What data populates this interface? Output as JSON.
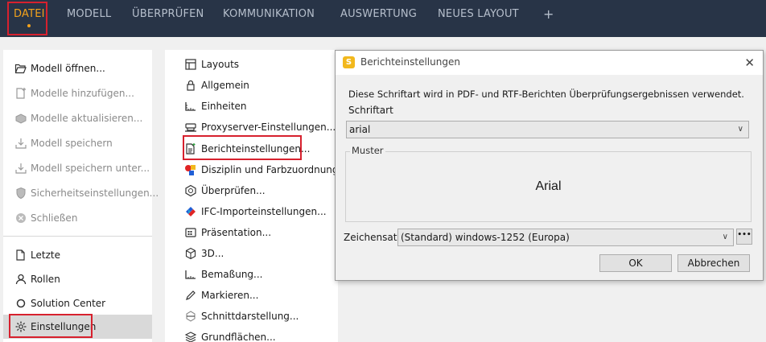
{
  "nav": {
    "tabs": [
      {
        "label": "DATEI",
        "active": true
      },
      {
        "label": "MODELL"
      },
      {
        "label": "ÜBERPRÜFEN"
      },
      {
        "label": "KOMMUNIKATION"
      },
      {
        "label": "AUSWERTUNG"
      },
      {
        "label": "NEUES LAYOUT"
      }
    ],
    "add_label": "+"
  },
  "sidebar": {
    "items": [
      {
        "label": "Modell öffnen...",
        "icon": "folder-open-icon",
        "enabled": true
      },
      {
        "label": "Modelle hinzufügen...",
        "icon": "add-file-icon",
        "enabled": false
      },
      {
        "label": "Modelle aktualisieren...",
        "icon": "refresh-models-icon",
        "enabled": false
      },
      {
        "label": "Modell speichern",
        "icon": "save-download-icon",
        "enabled": false
      },
      {
        "label": "Modell speichern unter...",
        "icon": "save-as-icon",
        "enabled": false
      },
      {
        "label": "Sicherheitseinstellungen...",
        "icon": "shield-icon",
        "enabled": false
      },
      {
        "label": "Schließen",
        "icon": "close-circle-icon",
        "enabled": false
      },
      {
        "label": "Letzte",
        "icon": "recent-file-icon",
        "enabled": true
      },
      {
        "label": "Rollen",
        "icon": "user-icon",
        "enabled": true
      },
      {
        "label": "Solution Center",
        "icon": "circle-icon",
        "enabled": true
      },
      {
        "label": "Einstellungen",
        "icon": "gear-icon",
        "enabled": true,
        "selected": true
      }
    ]
  },
  "settings": {
    "items": [
      {
        "label": "Layouts",
        "icon": "layout-grid-icon"
      },
      {
        "label": "Allgemein",
        "icon": "lock-icon"
      },
      {
        "label": "Einheiten",
        "icon": "ruler-icon"
      },
      {
        "label": "Proxyserver-Einstellungen...",
        "icon": "server-icon"
      },
      {
        "label": "Berichteinstellungen...",
        "icon": "report-file-icon"
      },
      {
        "label": "Disziplin und Farbzuordnung...",
        "icon": "color-shapes-icon"
      },
      {
        "label": "Überprüfen...",
        "icon": "check-shield-icon"
      },
      {
        "label": "IFC-Importeinstellungen...",
        "icon": "ifc-icon"
      },
      {
        "label": "Präsentation...",
        "icon": "presentation-icon"
      },
      {
        "label": "3D...",
        "icon": "cube-icon"
      },
      {
        "label": "Bemaßung...",
        "icon": "dimension-icon"
      },
      {
        "label": "Markieren...",
        "icon": "pencil-icon"
      },
      {
        "label": "Schnittdarstellung...",
        "icon": "section-icon"
      },
      {
        "label": "Grundflächen...",
        "icon": "layers-icon"
      }
    ]
  },
  "dialog": {
    "title": "Berichteinstellungen",
    "logo_letter": "S",
    "close_label": "✕",
    "description": "Diese Schriftart wird in PDF- und RTF-Berichten Überprüfungsergebnissen verwendet.",
    "font_label": "Schriftart",
    "font_value": "arial",
    "sample_label": "Muster",
    "sample_text": "Arial",
    "charset_label": "Zeichensatz",
    "charset_value": "(Standard) windows-1252 (Europa)",
    "more_label": "•••",
    "ok_label": "OK",
    "cancel_label": "Abbrechen"
  },
  "colors": {
    "topbar": "#283447",
    "accent": "#f3a21c",
    "highlight": "#d7212e",
    "logo": "#f2b81d"
  }
}
